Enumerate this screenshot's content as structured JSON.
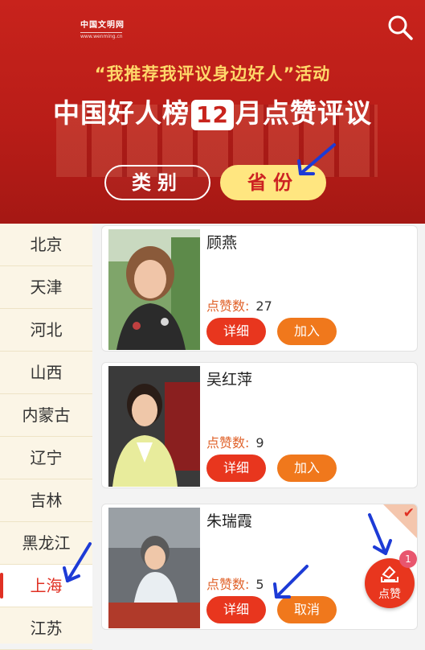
{
  "banner": {
    "logo_title": "中国文明网",
    "logo_url": "www.wenming.cn",
    "subtitle": "“我推荐我评议身边好人”活动",
    "title_prefix": "中国好人榜",
    "title_month": "12",
    "title_suffix": "月点赞评议",
    "tabs": {
      "category": "类别",
      "province": "省份"
    }
  },
  "sidebar": {
    "items": [
      {
        "label": "北京"
      },
      {
        "label": "天津"
      },
      {
        "label": "河北"
      },
      {
        "label": "山西"
      },
      {
        "label": "内蒙古"
      },
      {
        "label": "辽宁"
      },
      {
        "label": "吉林"
      },
      {
        "label": "黑龙江"
      },
      {
        "label": "上海"
      },
      {
        "label": "江苏"
      }
    ],
    "active": "上海"
  },
  "cards": [
    {
      "name": "顾燕",
      "likes_label": "点赞数:",
      "likes": "27",
      "detail": "详细",
      "action": "加入"
    },
    {
      "name": "吴红萍",
      "likes_label": "点赞数:",
      "likes": "9",
      "detail": "详细",
      "action": "加入"
    },
    {
      "name": "朱瑞霞",
      "likes_label": "点赞数:",
      "likes": "5",
      "detail": "详细",
      "action": "取消"
    }
  ],
  "fab": {
    "label": "点赞",
    "badge": "1"
  },
  "colors": {
    "banner": "#c8231c",
    "accent": "#e8361e",
    "secondary": "#f0781c",
    "highlight": "#ffe680"
  }
}
